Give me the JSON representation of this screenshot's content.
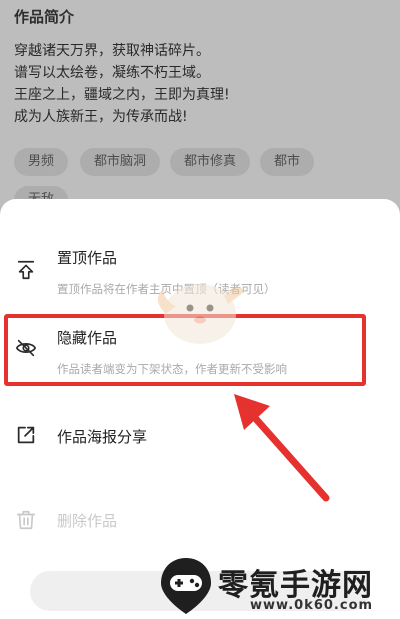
{
  "background": {
    "section_title": "作品简介",
    "intro_lines": [
      "穿越诸天万界，获取神话碎片。",
      "谱写以太绘卷，凝练不朽王域。",
      "王座之上，疆域之内，王即为真理!",
      "成为人族新王，为传承而战!"
    ],
    "tags": [
      "男频",
      "都市脑洞",
      "都市修真",
      "都市",
      "无敌"
    ]
  },
  "sheet": {
    "pin": {
      "label": "置顶作品",
      "desc": "置顶作品将在作者主页中置顶（读者可见）",
      "icon": "pin-top-icon"
    },
    "hide": {
      "label": "隐藏作品",
      "desc": "作品读者端变为下架状态，作者更新不受影响",
      "icon": "eye-off-icon"
    },
    "share": {
      "label": "作品海报分享",
      "icon": "external-share-icon"
    },
    "delete": {
      "label": "删除作品",
      "icon": "trash-icon"
    }
  },
  "annotation": {
    "highlight_color": "#e5322f"
  },
  "watermark": {
    "title": "零氪手游网",
    "url": "www.0k60.com"
  }
}
